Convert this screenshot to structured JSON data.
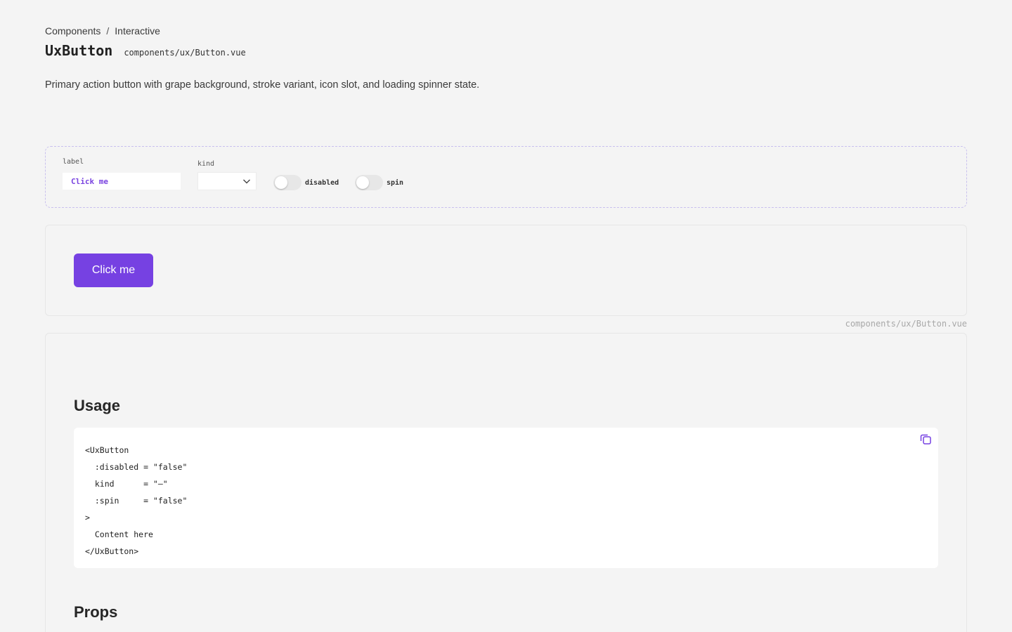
{
  "breadcrumb": {
    "items": [
      "Components",
      "Interactive"
    ],
    "separator": "/"
  },
  "header": {
    "title": "UxButton",
    "path": "components/ux/Button.vue"
  },
  "description": "Primary action button with grape background, stroke variant, icon slot, and loading spinner state.",
  "controls": {
    "label_caption": "label",
    "label_value": "Click me",
    "kind_caption": "kind",
    "kind_value": "",
    "toggles": [
      {
        "label": "disabled",
        "on": false
      },
      {
        "label": "spin",
        "on": false
      }
    ]
  },
  "preview": {
    "button_label": "Click me",
    "file_caption": "components/ux/Button.vue"
  },
  "usage": {
    "heading": "Usage",
    "code": "<UxButton\n  :disabled = \"false\"\n  kind      = \"—\"\n  :spin     = \"false\"\n>\n  Content here\n</UxButton>",
    "copy_icon": "copy-icon"
  },
  "props": {
    "heading": "Props"
  },
  "colors": {
    "accent": "#7641e2",
    "background": "#f4f4f4"
  }
}
